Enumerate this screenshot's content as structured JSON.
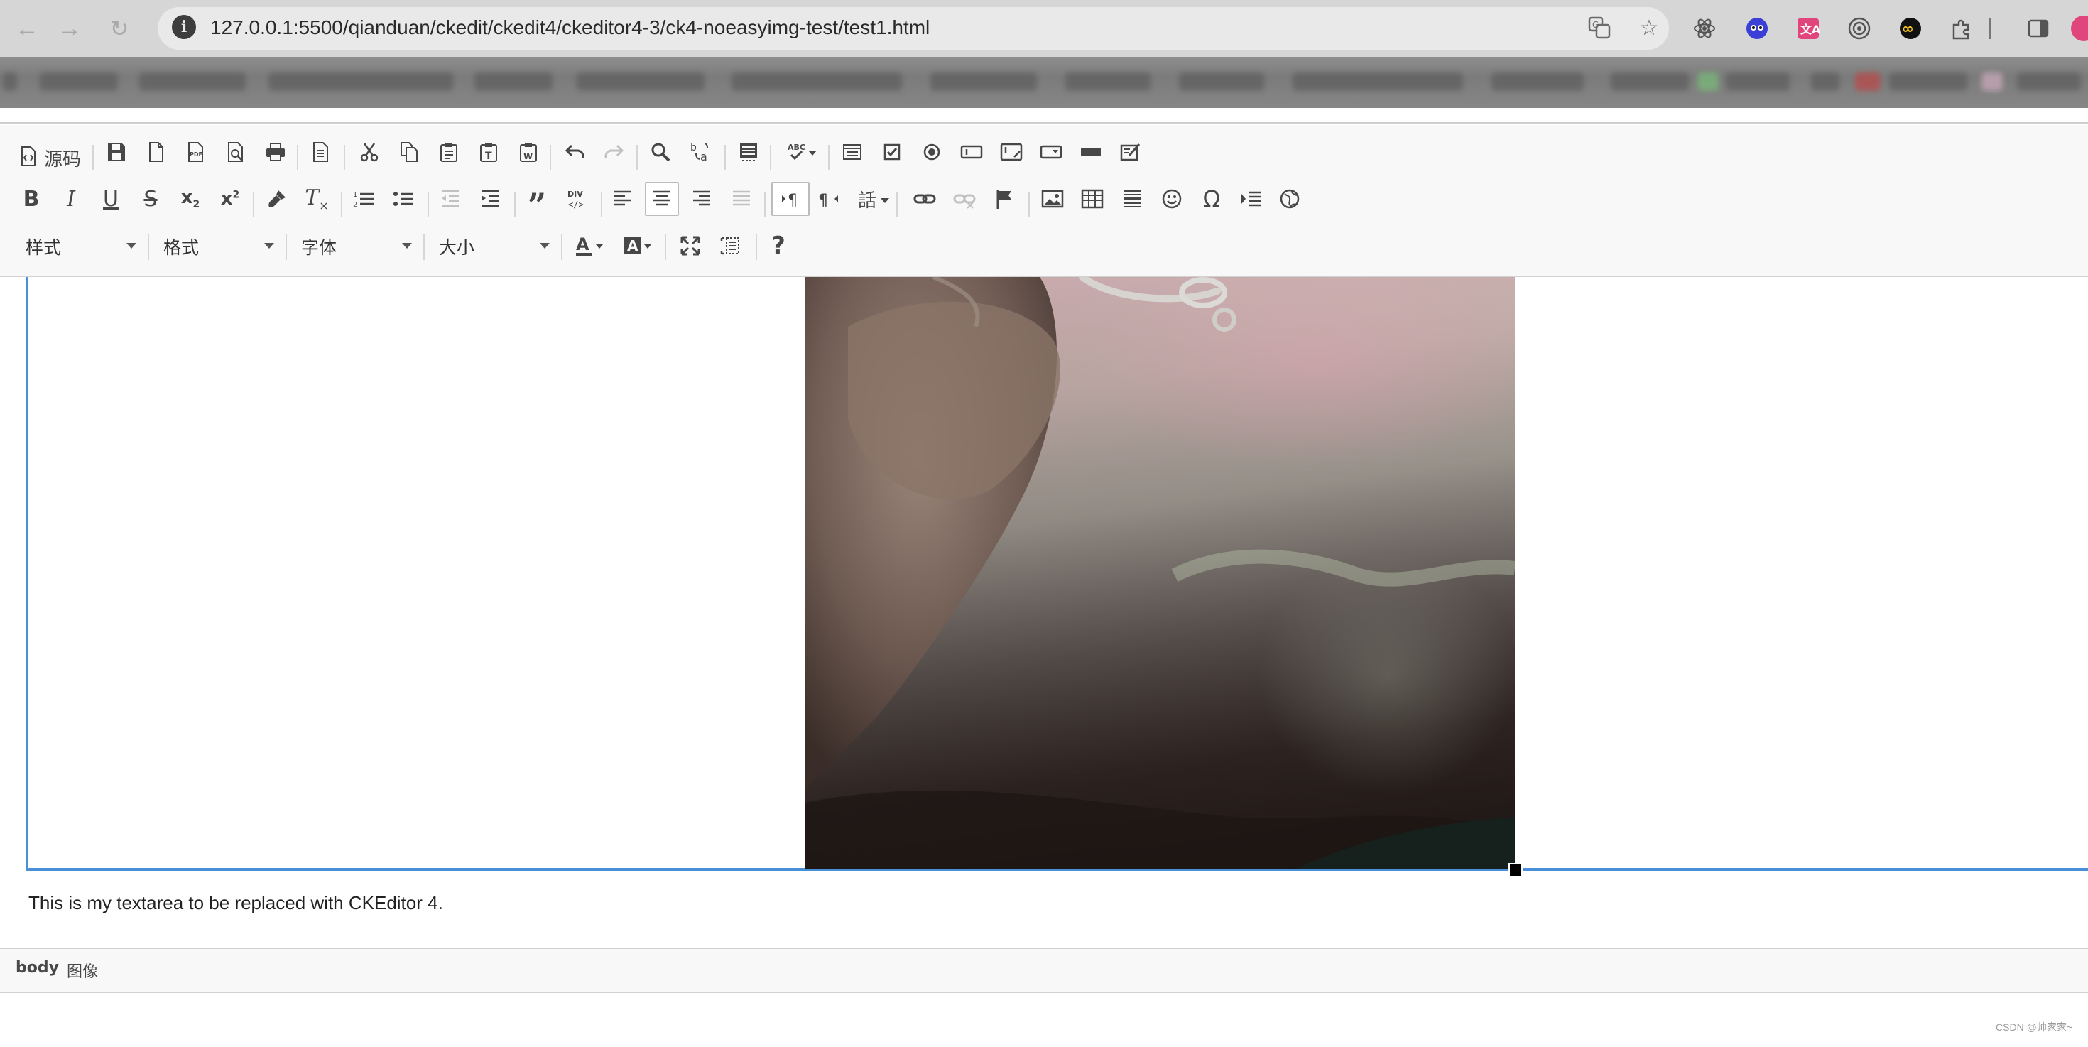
{
  "browser": {
    "url": "127.0.0.1:5500/qianduan/ckedit/ckedit4/ckeditor4-3/ck4-noeasyimg-test/test1.html",
    "back_icon": "arrow-left-icon",
    "forward_icon": "arrow-right-icon",
    "reload_icon": "reload-icon",
    "info_icon": "info-icon"
  },
  "toolbar": {
    "source_label": "源码",
    "styles_combo": "样式",
    "format_combo": "格式",
    "font_combo": "字体",
    "size_combo": "大小"
  },
  "editor": {
    "paragraph": "This is my textarea to be replaced with CKEditor 4.",
    "selection_color": "#4a90d9"
  },
  "statusbar": {
    "path": [
      "body",
      "图像"
    ]
  },
  "watermark": "CSDN @帅家家~"
}
